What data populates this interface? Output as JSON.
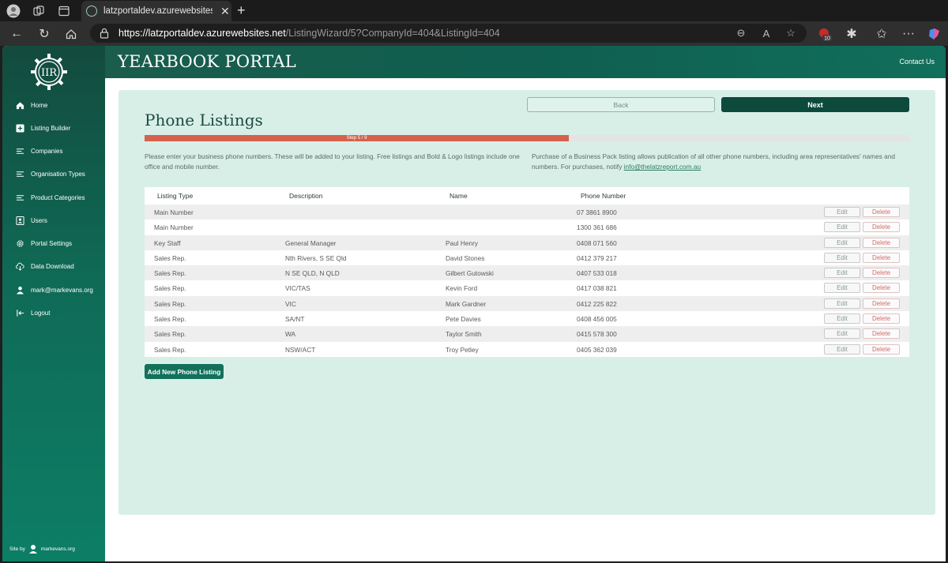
{
  "browser": {
    "tab_title": "latzportaldev.azurewebsites.net/L",
    "url_host": "https://latzportaldev.azurewebsites.net",
    "url_path": "/ListingWizard/5?CompanyId=404&ListingId=404",
    "extension_badge": "10"
  },
  "app": {
    "brand": "YEARBOOK PORTAL",
    "contact_label": "Contact Us",
    "logo_text": "IIR"
  },
  "sidebar": {
    "items": [
      {
        "label": "Home",
        "icon": "home-icon"
      },
      {
        "label": "Listing Builder",
        "icon": "plus-box-icon"
      },
      {
        "label": "Companies",
        "icon": "list-icon"
      },
      {
        "label": "Organisation Types",
        "icon": "list-icon"
      },
      {
        "label": "Product Categories",
        "icon": "list-icon"
      },
      {
        "label": "Users",
        "icon": "user-card-icon"
      },
      {
        "label": "Portal Settings",
        "icon": "gear-icon"
      },
      {
        "label": "Data Download",
        "icon": "cloud-download-icon"
      },
      {
        "label": "mark@markevans.org",
        "icon": "person-icon"
      },
      {
        "label": "Logout",
        "icon": "logout-icon"
      }
    ],
    "credit_prefix": "Site by",
    "credit_name": "markevans.org"
  },
  "wizard": {
    "back_label": "Back",
    "next_label": "Next",
    "title": "Phone Listings",
    "step_label": "Step 5 / 9",
    "progress": 0.555,
    "intro_left": "Please enter your business phone numbers. These will be added to your listing. Free listings and Bold & Logo listings include one office and mobile number.",
    "intro_right_text": "Purchase of a Business Pack listing allows publication of all other phone numbers, including area representatives' names and numbers. For purchases, notify",
    "intro_right_link": "info@thelatzreport.com.au",
    "add_label": "Add New Phone Listing"
  },
  "table": {
    "headers": [
      "Listing Type",
      "Description",
      "Name",
      "Phone Number"
    ],
    "edit_label": "Edit",
    "delete_label": "Delete",
    "rows": [
      {
        "type": "Main Number",
        "description": "",
        "name": "",
        "phone": "07 3861 8900"
      },
      {
        "type": "Main Number",
        "description": "",
        "name": "",
        "phone": "1300 361 686"
      },
      {
        "type": "Key Staff",
        "description": "General Manager",
        "name": "Paul Henry",
        "phone": "0408 071 560"
      },
      {
        "type": "Sales Rep.",
        "description": "Nth Rivers, S SE Qld",
        "name": "David Stones",
        "phone": "0412 379 217"
      },
      {
        "type": "Sales Rep.",
        "description": "N SE QLD, N QLD",
        "name": "Gilbert Gutowski",
        "phone": "0407 533 018"
      },
      {
        "type": "Sales Rep.",
        "description": "VIC/TAS",
        "name": "Kevin Ford",
        "phone": "0417 038 821"
      },
      {
        "type": "Sales Rep.",
        "description": "VIC",
        "name": "Mark Gardner",
        "phone": "0412 225 822"
      },
      {
        "type": "Sales Rep.",
        "description": "SA/NT",
        "name": "Pete Davies",
        "phone": "0408 456 005"
      },
      {
        "type": "Sales Rep.",
        "description": "WA",
        "name": "Taylor Smith",
        "phone": "0415 578 300"
      },
      {
        "type": "Sales Rep.",
        "description": "NSW/ACT",
        "name": "Troy Petley",
        "phone": "0405 362 039"
      }
    ]
  }
}
